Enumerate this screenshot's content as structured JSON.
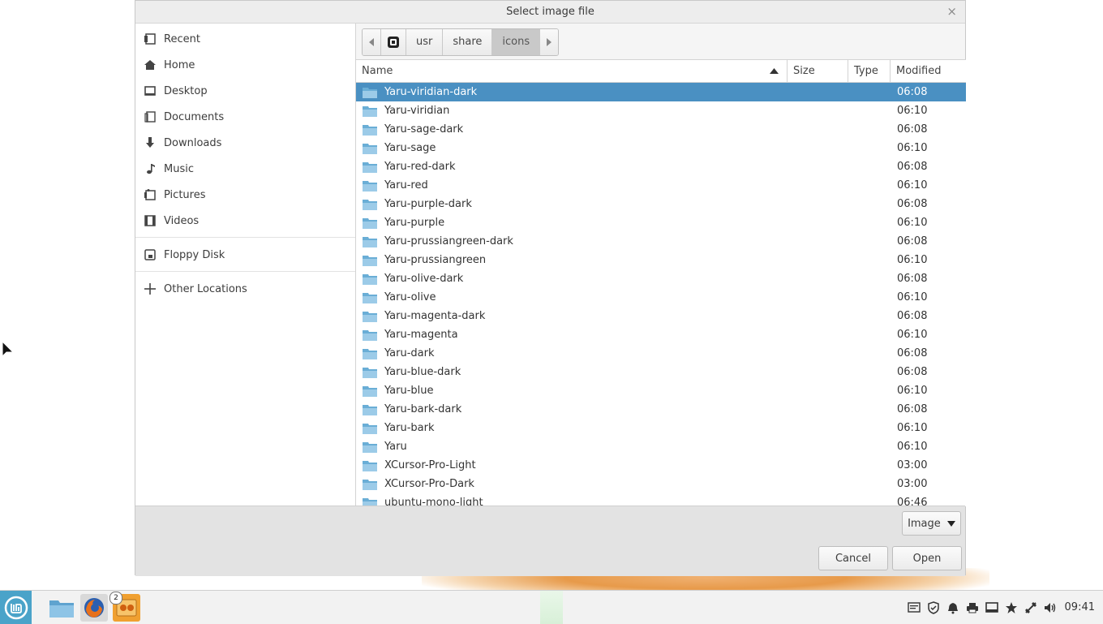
{
  "dialog": {
    "title": "Select image file",
    "close_label": "×"
  },
  "sidebar": {
    "items": [
      {
        "label": "Recent",
        "icon": "recent-icon"
      },
      {
        "label": "Home",
        "icon": "home-icon"
      },
      {
        "label": "Desktop",
        "icon": "desktop-icon"
      },
      {
        "label": "Documents",
        "icon": "documents-icon"
      },
      {
        "label": "Downloads",
        "icon": "downloads-icon"
      },
      {
        "label": "Music",
        "icon": "music-icon"
      },
      {
        "label": "Pictures",
        "icon": "pictures-icon"
      },
      {
        "label": "Videos",
        "icon": "videos-icon"
      },
      {
        "label": "Floppy Disk",
        "icon": "floppy-icon"
      },
      {
        "label": "Other Locations",
        "icon": "plus-icon"
      }
    ]
  },
  "pathbar": {
    "segments": [
      "usr",
      "share",
      "icons"
    ],
    "active": "icons"
  },
  "columns": {
    "name": "Name",
    "size": "Size",
    "type": "Type",
    "modified": "Modified"
  },
  "files": [
    {
      "name": "Yaru-viridian-dark",
      "size": "",
      "type": "",
      "modified": "06:08",
      "selected": true
    },
    {
      "name": "Yaru-viridian",
      "size": "",
      "type": "",
      "modified": "06:10"
    },
    {
      "name": "Yaru-sage-dark",
      "size": "",
      "type": "",
      "modified": "06:08"
    },
    {
      "name": "Yaru-sage",
      "size": "",
      "type": "",
      "modified": "06:10"
    },
    {
      "name": "Yaru-red-dark",
      "size": "",
      "type": "",
      "modified": "06:08"
    },
    {
      "name": "Yaru-red",
      "size": "",
      "type": "",
      "modified": "06:10"
    },
    {
      "name": "Yaru-purple-dark",
      "size": "",
      "type": "",
      "modified": "06:08"
    },
    {
      "name": "Yaru-purple",
      "size": "",
      "type": "",
      "modified": "06:10"
    },
    {
      "name": "Yaru-prussiangreen-dark",
      "size": "",
      "type": "",
      "modified": "06:08"
    },
    {
      "name": "Yaru-prussiangreen",
      "size": "",
      "type": "",
      "modified": "06:10"
    },
    {
      "name": "Yaru-olive-dark",
      "size": "",
      "type": "",
      "modified": "06:08"
    },
    {
      "name": "Yaru-olive",
      "size": "",
      "type": "",
      "modified": "06:10"
    },
    {
      "name": "Yaru-magenta-dark",
      "size": "",
      "type": "",
      "modified": "06:08"
    },
    {
      "name": "Yaru-magenta",
      "size": "",
      "type": "",
      "modified": "06:10"
    },
    {
      "name": "Yaru-dark",
      "size": "",
      "type": "",
      "modified": "06:08"
    },
    {
      "name": "Yaru-blue-dark",
      "size": "",
      "type": "",
      "modified": "06:08"
    },
    {
      "name": "Yaru-blue",
      "size": "",
      "type": "",
      "modified": "06:10"
    },
    {
      "name": "Yaru-bark-dark",
      "size": "",
      "type": "",
      "modified": "06:08"
    },
    {
      "name": "Yaru-bark",
      "size": "",
      "type": "",
      "modified": "06:10"
    },
    {
      "name": "Yaru",
      "size": "",
      "type": "",
      "modified": "06:10"
    },
    {
      "name": "XCursor-Pro-Light",
      "size": "",
      "type": "",
      "modified": "03:00"
    },
    {
      "name": "XCursor-Pro-Dark",
      "size": "",
      "type": "",
      "modified": "03:00"
    },
    {
      "name": "ubuntu-mono-light",
      "size": "",
      "type": "",
      "modified": "06:46"
    }
  ],
  "footer": {
    "filter_label": "Image",
    "cancel_label": "Cancel",
    "open_label": "Open"
  },
  "taskbar": {
    "badge_count": "2",
    "clock": "09:41"
  },
  "colors": {
    "selection": "#4a90c2",
    "menu_button": "#4aa3c9",
    "folder": "#6aaed6"
  }
}
